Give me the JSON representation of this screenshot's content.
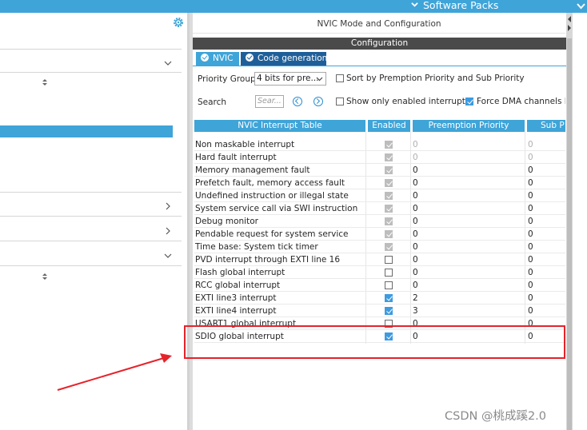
{
  "header": {
    "software_packs_label": "Software Packs"
  },
  "panel": {
    "title": "NVIC Mode and Configuration",
    "config_label": "Configuration"
  },
  "tabs": [
    {
      "label": "NVIC",
      "active": true
    },
    {
      "label": "Code generation",
      "active": false
    }
  ],
  "controls": {
    "priority_group_label": "Priority Group",
    "priority_group_value": "4 bits for pre...",
    "sort_label": "Sort by Premption Priority and Sub Priority",
    "sort_checked": false,
    "search_label": "Search",
    "search_placeholder": "Sear...",
    "show_enabled_label": "Show only enabled interrupts",
    "show_enabled_checked": false,
    "force_dma_label": "Force DMA channels In",
    "force_dma_checked": true
  },
  "table": {
    "headers": [
      "NVIC Interrupt Table",
      "Enabled",
      "Preemption Priority",
      "Sub P"
    ],
    "rows": [
      {
        "name": "Non maskable interrupt",
        "enabled": true,
        "locked": true,
        "pre": "0",
        "sub": "0",
        "muted": true
      },
      {
        "name": "Hard fault interrupt",
        "enabled": true,
        "locked": true,
        "pre": "0",
        "sub": "0",
        "muted": true
      },
      {
        "name": "Memory management fault",
        "enabled": true,
        "locked": true,
        "pre": "0",
        "sub": "0",
        "muted": false
      },
      {
        "name": "Prefetch fault, memory access fault",
        "enabled": true,
        "locked": true,
        "pre": "0",
        "sub": "0",
        "muted": false
      },
      {
        "name": "Undefined instruction or illegal state",
        "enabled": true,
        "locked": true,
        "pre": "0",
        "sub": "0",
        "muted": false
      },
      {
        "name": "System service call via SWI instruction",
        "enabled": true,
        "locked": true,
        "pre": "0",
        "sub": "0",
        "muted": false
      },
      {
        "name": "Debug monitor",
        "enabled": true,
        "locked": true,
        "pre": "0",
        "sub": "0",
        "muted": false
      },
      {
        "name": "Pendable request for system service",
        "enabled": true,
        "locked": true,
        "pre": "0",
        "sub": "0",
        "muted": false
      },
      {
        "name": "Time base: System tick timer",
        "enabled": true,
        "locked": true,
        "pre": "0",
        "sub": "0",
        "muted": false
      },
      {
        "name": "PVD interrupt through EXTI line 16",
        "enabled": false,
        "locked": false,
        "pre": "0",
        "sub": "0",
        "muted": false
      },
      {
        "name": "Flash global interrupt",
        "enabled": false,
        "locked": false,
        "pre": "0",
        "sub": "0",
        "muted": false
      },
      {
        "name": "RCC global interrupt",
        "enabled": false,
        "locked": false,
        "pre": "0",
        "sub": "0",
        "muted": false
      },
      {
        "name": "EXTI line3 interrupt",
        "enabled": true,
        "locked": false,
        "pre": "2",
        "sub": "0",
        "muted": false
      },
      {
        "name": "EXTI line4 interrupt",
        "enabled": true,
        "locked": false,
        "pre": "3",
        "sub": "0",
        "muted": false
      },
      {
        "name": "USART1 global interrupt",
        "enabled": false,
        "locked": false,
        "pre": "0",
        "sub": "0",
        "muted": false
      },
      {
        "name": "SDIO global interrupt",
        "enabled": true,
        "locked": false,
        "pre": "0",
        "sub": "0",
        "muted": false
      }
    ]
  },
  "watermark": "CSDN @桃成蹊2.0",
  "colors": {
    "accent": "#3fa4d8",
    "tab_dark": "#1f5f99",
    "header_dark": "#4a4a4a",
    "annotation": "#e5232b"
  },
  "icons": [
    "gear-icon",
    "chevron-down-icon",
    "chevron-right-icon",
    "sort-icon",
    "nav-previous-icon",
    "nav-next-icon",
    "check-icon"
  ]
}
